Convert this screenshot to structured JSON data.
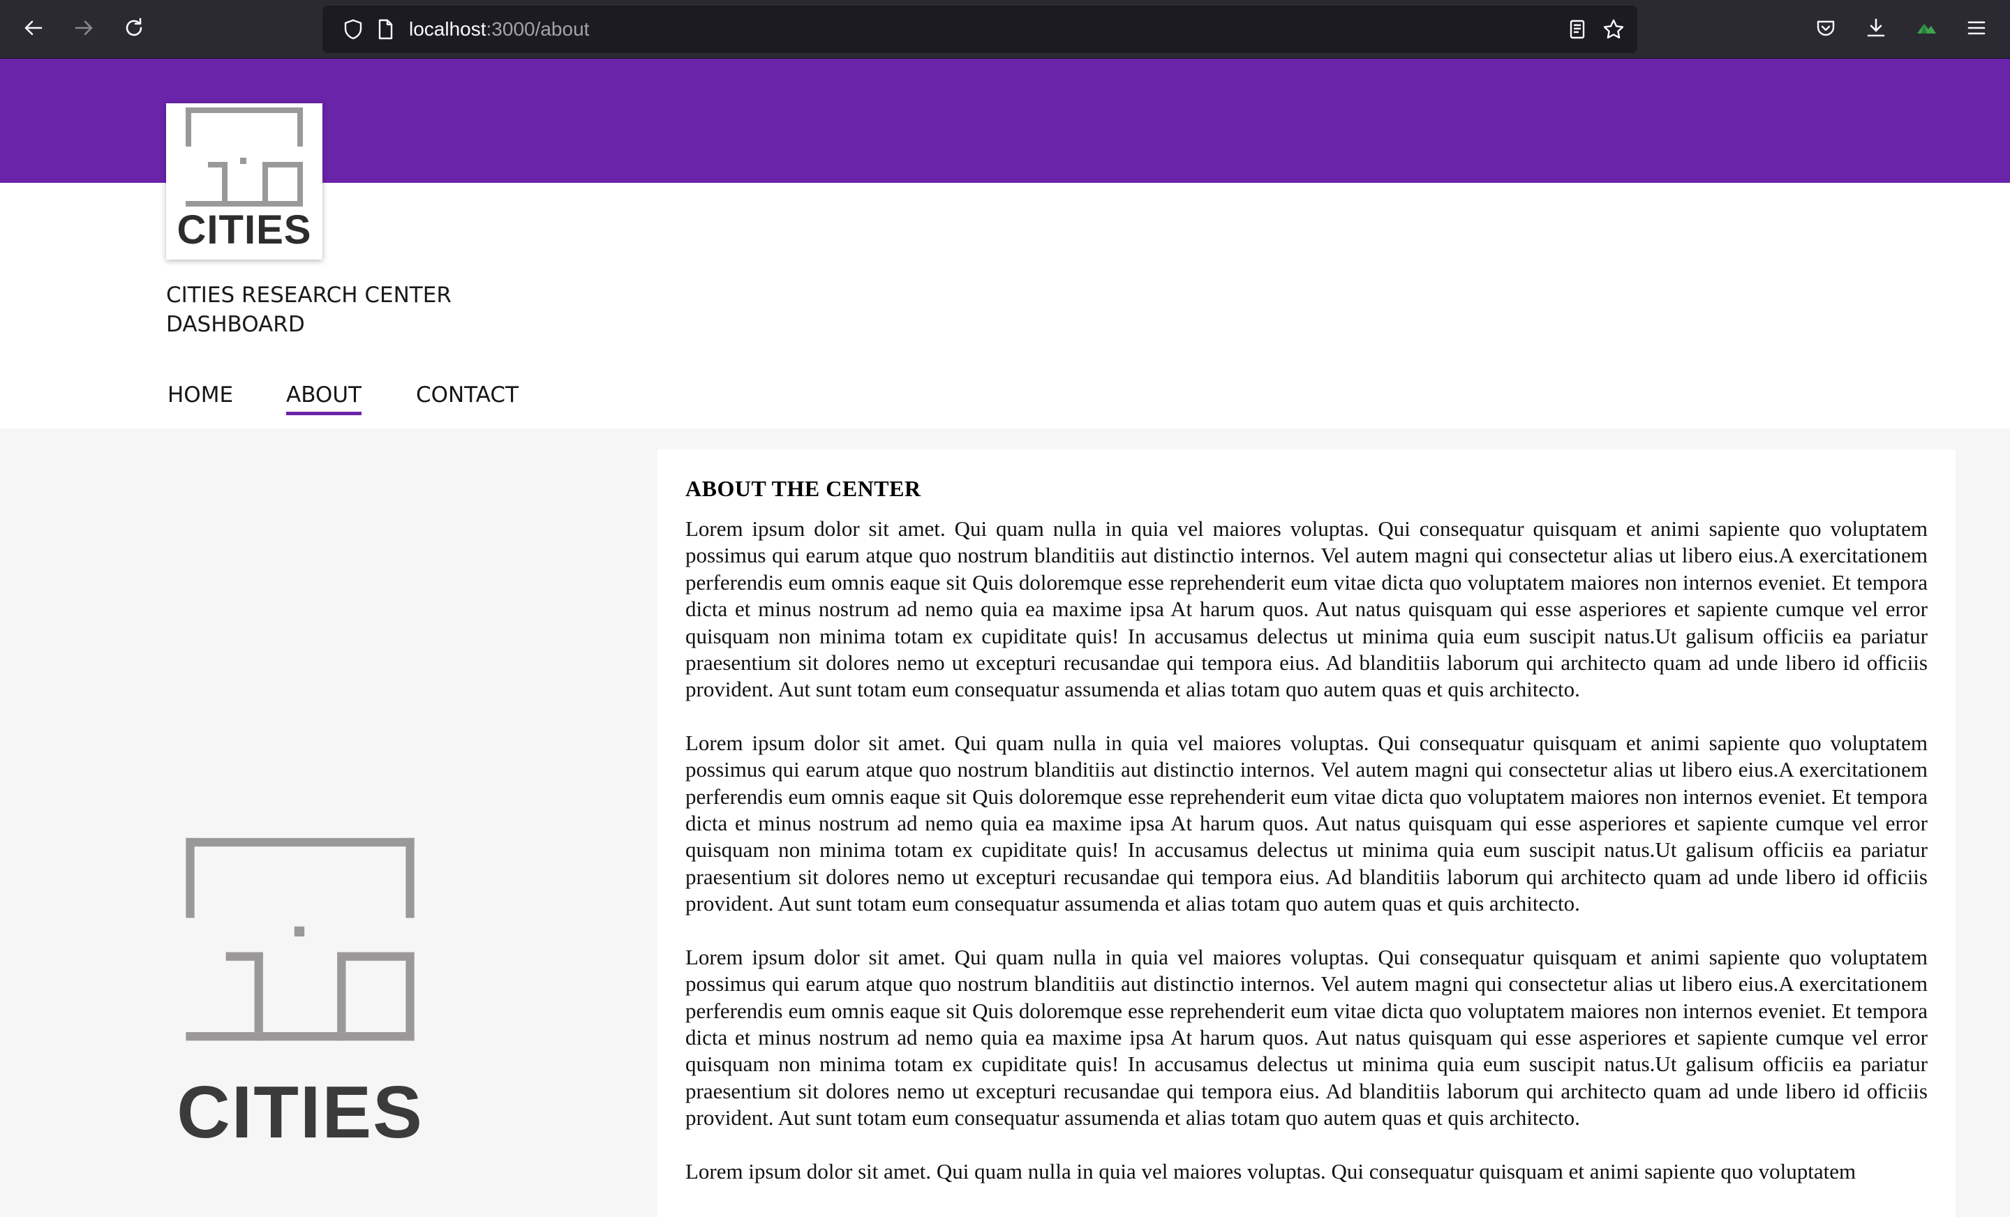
{
  "browser": {
    "url_host": "localhost",
    "url_path": ":3000/about"
  },
  "header": {
    "logo_text": "CITIES",
    "title_line1": "CITIES RESEARCH CENTER",
    "title_line2": "DASHBOARD"
  },
  "nav": {
    "items": [
      {
        "label": "HOME"
      },
      {
        "label": "ABOUT"
      },
      {
        "label": "CONTACT"
      }
    ],
    "active": "ABOUT"
  },
  "side_logo": {
    "text": "CITIES"
  },
  "content": {
    "title": "ABOUT THE CENTER",
    "paragraphs": [
      "Lorem ipsum dolor sit amet. Qui quam nulla in quia vel maiores voluptas. Qui consequatur quisquam et animi sapiente quo voluptatem possimus qui earum atque quo nostrum blanditiis aut distinctio internos. Vel autem magni qui consectetur alias ut libero eius.A exercitationem perferendis eum omnis eaque sit Quis doloremque esse reprehenderit eum vitae dicta quo voluptatem maiores non internos eveniet. Et tempora dicta et minus nostrum ad nemo quia ea maxime ipsa At harum quos. Aut natus quisquam qui esse asperiores et sapiente cumque vel error quisquam non minima totam ex cupiditate quis! In accusamus delectus ut minima quia eum suscipit natus.Ut galisum officiis ea pariatur praesentium sit dolores nemo ut excepturi recusandae qui tempora eius. Ad blanditiis laborum qui architecto quam ad unde libero id officiis provident. Aut sunt totam eum consequatur assumenda et alias totam quo autem quas et quis architecto.",
      "Lorem ipsum dolor sit amet. Qui quam nulla in quia vel maiores voluptas. Qui consequatur quisquam et animi sapiente quo voluptatem possimus qui earum atque quo nostrum blanditiis aut distinctio internos. Vel autem magni qui consectetur alias ut libero eius.A exercitationem perferendis eum omnis eaque sit Quis doloremque esse reprehenderit eum vitae dicta quo voluptatem maiores non internos eveniet. Et tempora dicta et minus nostrum ad nemo quia ea maxime ipsa At harum quos. Aut natus quisquam qui esse asperiores et sapiente cumque vel error quisquam non minima totam ex cupiditate quis! In accusamus delectus ut minima quia eum suscipit natus.Ut galisum officiis ea pariatur praesentium sit dolores nemo ut excepturi recusandae qui tempora eius. Ad blanditiis laborum qui architecto quam ad unde libero id officiis provident. Aut sunt totam eum consequatur assumenda et alias totam quo autem quas et quis architecto.",
      "Lorem ipsum dolor sit amet. Qui quam nulla in quia vel maiores voluptas. Qui consequatur quisquam et animi sapiente quo voluptatem possimus qui earum atque quo nostrum blanditiis aut distinctio internos. Vel autem magni qui consectetur alias ut libero eius.A exercitationem perferendis eum omnis eaque sit Quis doloremque esse reprehenderit eum vitae dicta quo voluptatem maiores non internos eveniet. Et tempora dicta et minus nostrum ad nemo quia ea maxime ipsa At harum quos. Aut natus quisquam qui esse asperiores et sapiente cumque vel error quisquam non minima totam ex cupiditate quis! In accusamus delectus ut minima quia eum suscipit natus.Ut galisum officiis ea pariatur praesentium sit dolores nemo ut excepturi recusandae qui tempora eius. Ad blanditiis laborum qui architecto quam ad unde libero id officiis provident. Aut sunt totam eum consequatur assumenda et alias totam quo autem quas et quis architecto.",
      "Lorem ipsum dolor sit amet. Qui quam nulla in quia vel maiores voluptas. Qui consequatur quisquam et animi sapiente quo voluptatem"
    ]
  },
  "colors": {
    "brand_purple": "#6a24aa",
    "toolbar_bg": "#2b2a33",
    "urlbar_bg": "#1c1b22",
    "page_bg": "#f6f6f6"
  },
  "icons": {
    "back": "arrow-left-icon",
    "forward": "arrow-right-icon",
    "reload": "reload-icon",
    "tracking": "shield-icon",
    "page": "page-icon",
    "reader": "reader-view-icon",
    "bookmark": "star-icon",
    "pocket": "pocket-icon",
    "downloads": "download-icon",
    "extension": "extension-icon",
    "menu": "hamburger-menu-icon"
  }
}
